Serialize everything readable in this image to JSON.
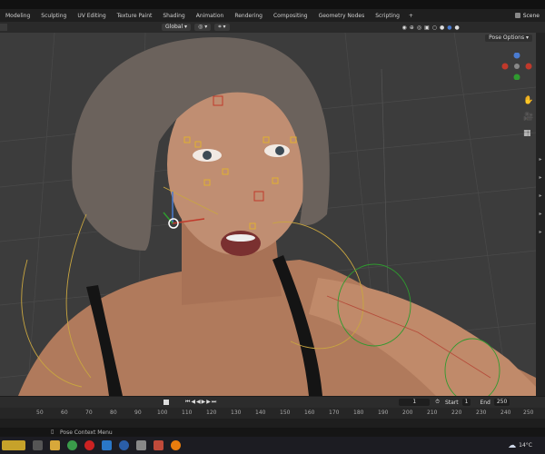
{
  "workspace_tabs": [
    "Modeling",
    "Sculpting",
    "UV Editing",
    "Texture Paint",
    "Shading",
    "Animation",
    "Rendering",
    "Compositing",
    "Geometry Nodes",
    "Scripting"
  ],
  "add_tab_label": "+",
  "scene_label": "Scene",
  "header": {
    "orientation_label": "Global",
    "pose_options_label": "Pose Options"
  },
  "timeline": {
    "current_frame": "1",
    "start_label": "Start",
    "start_value": "1",
    "end_label": "End",
    "end_value": "250",
    "ruler_ticks": [
      "50",
      "60",
      "70",
      "80",
      "90",
      "100",
      "110",
      "120",
      "130",
      "140",
      "150",
      "160",
      "170",
      "180",
      "190",
      "200",
      "210",
      "220",
      "230",
      "240",
      "250"
    ]
  },
  "status": {
    "context_menu_label": "Pose Context Menu"
  },
  "taskbar": {
    "temperature": "14°C"
  },
  "colors": {
    "accent": "#4a7bd0",
    "viewport": "#3c3c3c"
  }
}
